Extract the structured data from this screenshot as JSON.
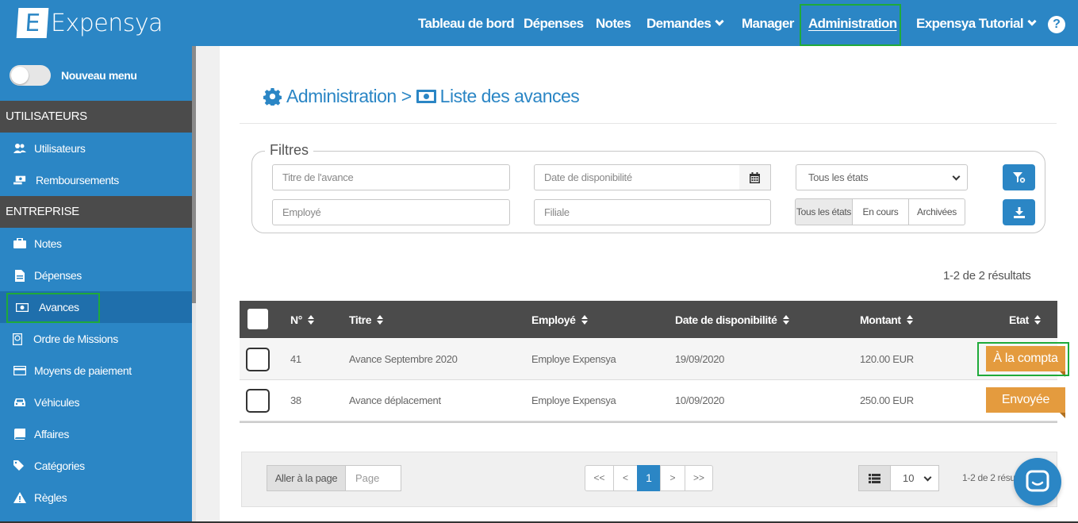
{
  "app": {
    "logo_letter": "E",
    "logo_text": "Expensya",
    "brand_color": "#2b86c5",
    "highlight_color": "#1faa3a"
  },
  "nav": {
    "items": [
      {
        "label": "Tableau de bord"
      },
      {
        "label": "Dépenses"
      },
      {
        "label": "Notes"
      },
      {
        "label": "Demandes",
        "dropdown": true
      },
      {
        "label": "Manager"
      },
      {
        "label": "Administration",
        "active": true
      },
      {
        "label": "Expensya Tutorial",
        "dropdown": true
      }
    ],
    "help_label": "?"
  },
  "sidebar": {
    "toggle_label": "Nouveau menu",
    "sections": [
      {
        "title": "UTILISATEURS",
        "items": [
          {
            "label": "Utilisateurs",
            "icon": "users-icon"
          },
          {
            "label": "Remboursements",
            "icon": "refund-icon"
          }
        ]
      },
      {
        "title": "ENTREPRISE",
        "items": [
          {
            "label": "Notes",
            "icon": "briefcase-icon"
          },
          {
            "label": "Dépenses",
            "icon": "document-icon"
          },
          {
            "label": "Avances",
            "icon": "money-icon",
            "active": true
          },
          {
            "label": "Ordre de Missions",
            "icon": "passport-icon"
          },
          {
            "label": "Moyens de paiement",
            "icon": "credit-card-icon"
          },
          {
            "label": "Véhicules",
            "icon": "car-icon"
          },
          {
            "label": "Affaires",
            "icon": "book-icon"
          },
          {
            "label": "Catégories",
            "icon": "tags-icon"
          },
          {
            "label": "Règles",
            "icon": "warning-icon"
          }
        ]
      }
    ]
  },
  "page": {
    "breadcrumb_root": "Administration",
    "breadcrumb_sep": ">",
    "breadcrumb_current": "Liste des avances"
  },
  "filters": {
    "legend": "Filtres",
    "title_placeholder": "Titre de l'avance",
    "date_placeholder": "Date de disponibilité",
    "state_select": "Tous les états",
    "employee_placeholder": "Employé",
    "subsidiary_placeholder": "Filiale",
    "segments": [
      {
        "label": "Tous les états",
        "active": true
      },
      {
        "label": "En cours"
      },
      {
        "label": "Archivées"
      }
    ]
  },
  "results_text": "1-2 de 2 résultats",
  "table": {
    "columns": [
      "N°",
      "Titre",
      "Employé",
      "Date de disponibilité",
      "Montant",
      "Etat"
    ],
    "rows": [
      {
        "num": "41",
        "title": "Avance Septembre 2020",
        "employee": "Employe Expensya",
        "date": "19/09/2020",
        "amount": "120.00 EUR",
        "state": "À la compta"
      },
      {
        "num": "38",
        "title": "Avance déplacement",
        "employee": "Employe Expensya",
        "date": "10/09/2020",
        "amount": "250.00 EUR",
        "state": "Envoyée"
      }
    ],
    "badge_color": "#e49b3e"
  },
  "pagination": {
    "goto_label": "Aller à la page",
    "page_placeholder": "Page",
    "first": "<<",
    "prev": "<",
    "current": "1",
    "next": ">",
    "last": ">>",
    "per_page": "10",
    "count_text": "1-2 de 2 résu"
  }
}
